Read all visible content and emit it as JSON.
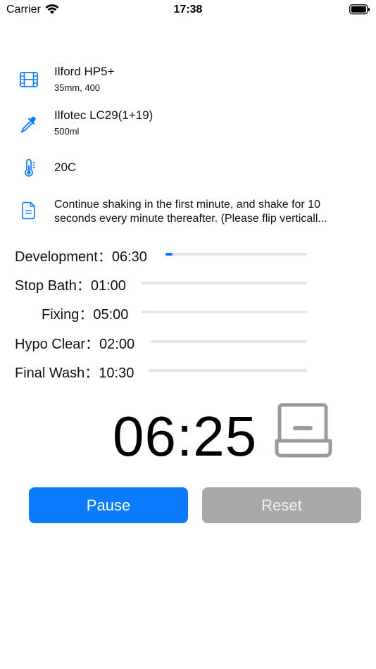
{
  "status_bar": {
    "carrier": "Carrier",
    "time": "17:38"
  },
  "film": {
    "icon": "film-icon",
    "name": "Ilford HP5+",
    "detail": "35mm, 400"
  },
  "developer": {
    "icon": "dropper-icon",
    "name": "Ilfotec LC29(1+19)",
    "detail": "500ml"
  },
  "temperature": {
    "icon": "thermometer-icon",
    "value": "20C"
  },
  "note": {
    "icon": "document-icon",
    "text": "Continue shaking in the first minute, and shake for 10 seconds every minute thereafter. (Please flip verticall..."
  },
  "steps": [
    {
      "label": "Development：06:30",
      "progress": 0.05
    },
    {
      "label": "Stop Bath：01:00",
      "progress": 0
    },
    {
      "label": "Fixing：05:00",
      "progress": 0
    },
    {
      "label": "Hypo Clear：02:00",
      "progress": 0
    },
    {
      "label": "Final Wash：10:30",
      "progress": 0
    }
  ],
  "timer": {
    "readout": "06:25",
    "icon": "developing-tank-icon"
  },
  "controls": {
    "pause_label": "Pause",
    "reset_label": "Reset"
  },
  "colors": {
    "accent": "#0a7aff",
    "disabled": "#a9a9ab",
    "track": "#e4e4e6"
  }
}
